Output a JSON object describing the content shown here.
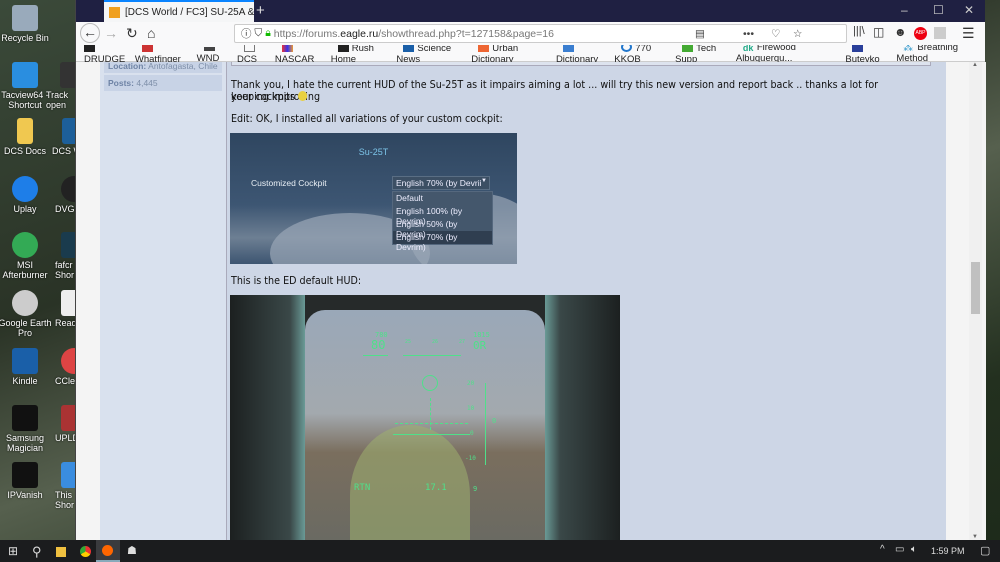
{
  "desktop": {
    "icons_left": [
      "Recycle Bin",
      "Tacview64 - Shortcut",
      "DCS Docs",
      "Uplay",
      "MSI Afterburner",
      "Google Earth Pro",
      "Kindle",
      "Samsung Magician",
      "IPVanish"
    ],
    "icons_right": [
      "",
      "Track open",
      "DCS W",
      "DVG",
      "fafcr Shor",
      "Read",
      "CCle",
      "UPLD M",
      "This Shor"
    ]
  },
  "browser": {
    "tab_title": "[DCS World / FC3] SU-25A & SU",
    "url_prefix": "https://forums.",
    "url_domain": "eagle.ru",
    "url_path": "/showthread.php?t=127158&page=16",
    "bookmarks": [
      "DRUDGE",
      "Whatfinger",
      "WND",
      "DCS",
      "NASCAR",
      "Rush Home",
      "Science News",
      "Urban Dictionary",
      "Dictionary",
      "770 KKOB",
      "Tech Supp",
      "Firewood Albuquerqu...",
      "Buteyko",
      "Breathing Method"
    ],
    "abp_label": "ABP"
  },
  "sidebar": {
    "location_label": "Location:",
    "location_value": "Antofagasta, Chile",
    "posts_label": "Posts:",
    "posts_value": "4,445"
  },
  "post": {
    "line1": "Thank you, I hate the current HUD of the Su-25T as it impairs aiming a lot ... will try this new version and report back .. thanks a lot for keeping improving",
    "line2": "your cockpits",
    "edit_line": "Edit: OK, I installed all variations of your custom cockpit:",
    "default_hud_line": "This is the ED default HUD:",
    "settings_shot": {
      "title": "Su-25T",
      "label": "Customized Cockpit",
      "selected": "English 70% (by Devrii",
      "options": [
        "Default",
        "English 100% (by Devrim)",
        "English 50% (by Devrim)",
        "English 70% (by Devrim)"
      ]
    },
    "hud": {
      "speed_top": "780",
      "speed": "80",
      "alt_top": "1815",
      "alt": "0R",
      "heading_ticks": [
        "25",
        "26",
        "27"
      ],
      "pitch": [
        "20",
        "10",
        "0",
        "-10"
      ],
      "vv": "0",
      "mode": "RTN",
      "range": "17.1",
      "g": "9"
    }
  },
  "taskbar": {
    "time": "1:59 PM"
  }
}
